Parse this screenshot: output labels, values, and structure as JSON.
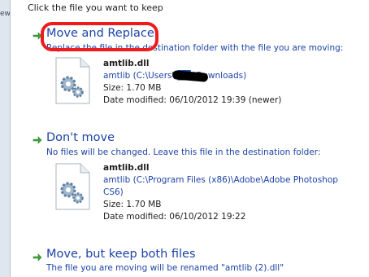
{
  "prompt": "Click the file you want to keep",
  "side_window_fragment": "ew",
  "options": [
    {
      "title": "Move and Replace",
      "description": "Replace the file in the destination folder with the file you are moving:",
      "file": {
        "name": "amtlib.dll",
        "path": "amtlib (C:\\Users\\ ██ \\Downloads)",
        "size": "Size: 1.70 MB",
        "modified": "Date modified: 06/10/2012 19:39 (newer)"
      }
    },
    {
      "title": "Don't move",
      "description": "No files will be changed. Leave this file in the destination folder:",
      "file": {
        "name": "amtlib.dll",
        "path_line1": "amtlib (C:\\Program Files (x86)\\Adobe\\Adobe Photoshop",
        "path_line2": "CS6)",
        "size": "Size: 1.70 MB",
        "modified": "Date modified: 06/10/2012 19:22"
      }
    },
    {
      "title": "Move, but keep both files",
      "description": "The file you are moving will be renamed \"amtlib (2).dll\""
    }
  ],
  "icons": {
    "arrow": "green-right-arrow-icon",
    "file": "dll-file-gear-icon"
  },
  "colors": {
    "link_blue": "#1d43a6",
    "arrow_green": "#3aa53a",
    "annotation_red": "#ee1c1c"
  }
}
